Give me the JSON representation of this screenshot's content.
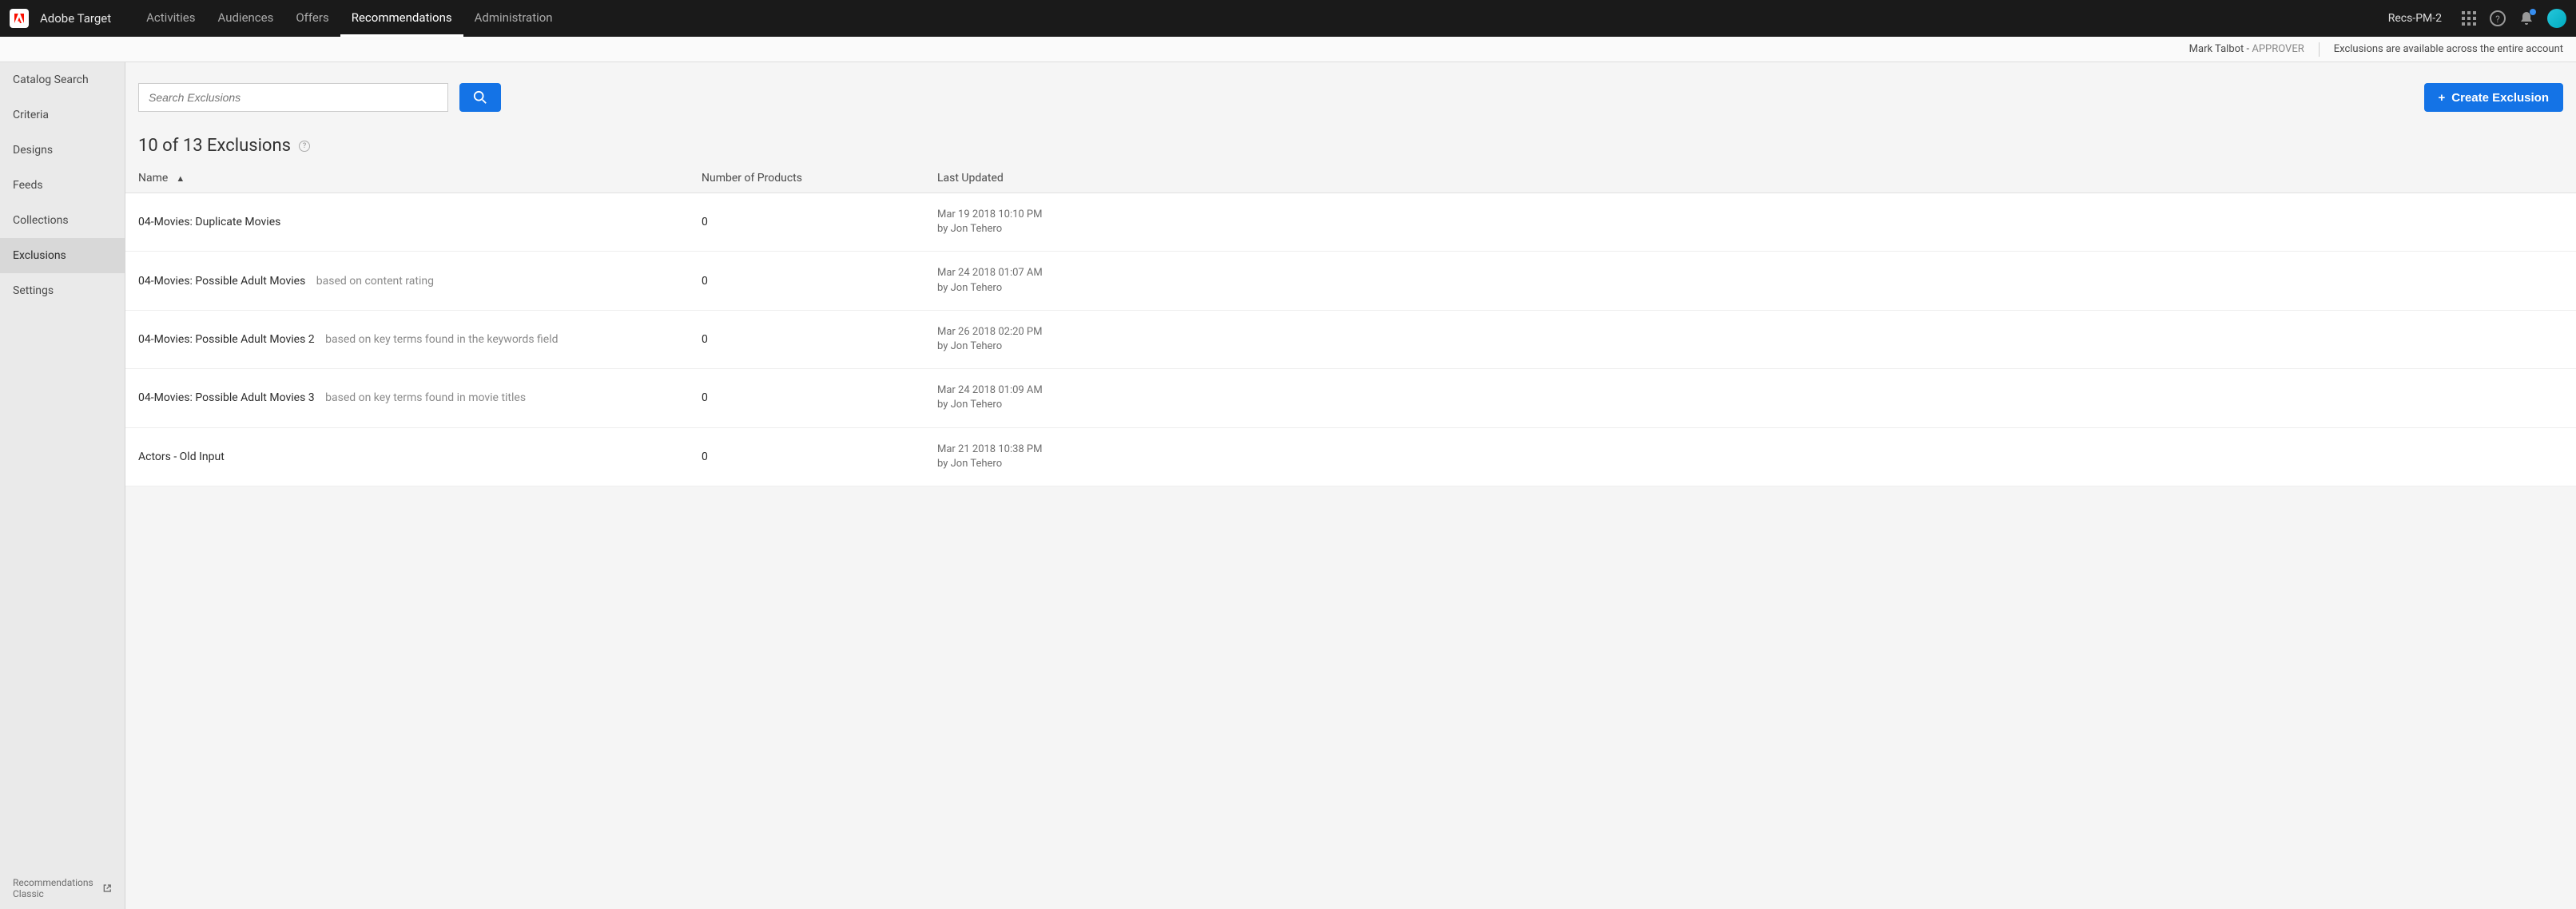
{
  "header": {
    "product": "Adobe Target",
    "nav": [
      {
        "label": "Activities",
        "active": false
      },
      {
        "label": "Audiences",
        "active": false
      },
      {
        "label": "Offers",
        "active": false
      },
      {
        "label": "Recommendations",
        "active": true
      },
      {
        "label": "Administration",
        "active": false
      }
    ],
    "workspace": "Recs-PM-2"
  },
  "subheader": {
    "username": "Mark Talbot",
    "role": "APPROVER",
    "scope": "Exclusions are available across the entire account"
  },
  "sidebar": {
    "items": [
      {
        "label": "Catalog Search",
        "active": false
      },
      {
        "label": "Criteria",
        "active": false
      },
      {
        "label": "Designs",
        "active": false
      },
      {
        "label": "Feeds",
        "active": false
      },
      {
        "label": "Collections",
        "active": false
      },
      {
        "label": "Exclusions",
        "active": true
      },
      {
        "label": "Settings",
        "active": false
      }
    ],
    "classic": "Recommendations Classic"
  },
  "content": {
    "search_placeholder": "Search Exclusions",
    "create_label": "Create Exclusion",
    "list_title": "10 of 13 Exclusions",
    "columns": {
      "name": "Name",
      "count": "Number of Products",
      "updated": "Last Updated"
    },
    "rows": [
      {
        "name": "04-Movies: Duplicate Movies",
        "desc": "",
        "count": "0",
        "date": "Mar 19 2018 10:10 PM",
        "by": "by Jon Tehero"
      },
      {
        "name": "04-Movies: Possible Adult Movies",
        "desc": "based on content rating",
        "count": "0",
        "date": "Mar 24 2018 01:07 AM",
        "by": "by Jon Tehero"
      },
      {
        "name": "04-Movies: Possible Adult Movies 2",
        "desc": "based on key terms found in the keywords field",
        "count": "0",
        "date": "Mar 26 2018 02:20 PM",
        "by": "by Jon Tehero"
      },
      {
        "name": "04-Movies: Possible Adult Movies 3",
        "desc": "based on key terms found in movie titles",
        "count": "0",
        "date": "Mar 24 2018 01:09 AM",
        "by": "by Jon Tehero"
      },
      {
        "name": "Actors - Old Input",
        "desc": "",
        "count": "0",
        "date": "Mar 21 2018 10:38 PM",
        "by": "by Jon Tehero"
      }
    ]
  }
}
